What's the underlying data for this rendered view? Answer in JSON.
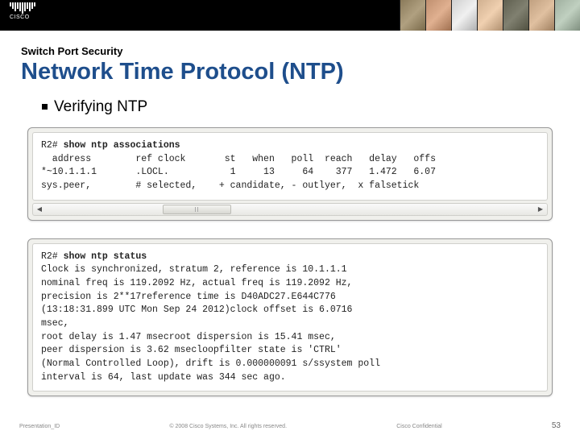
{
  "header": {
    "logo_text": "CISCO"
  },
  "kicker": "Switch Port Security",
  "title": "Network Time Protocol (NTP)",
  "bullet": "Verifying NTP",
  "terminal1": {
    "prompt": "R2#",
    "command": "show ntp associations",
    "line1": "  address        ref clock       st   when   poll  reach   delay   offs",
    "line2": "*~10.1.1.1       .LOCL.           1     13     64    377   1.472   6.07",
    "line3": "sys.peer,        # selected,    + candidate, - outlyer,  x falsetick"
  },
  "terminal2": {
    "prompt": "R2#",
    "command": "show ntp status",
    "line1": "Clock is synchronized, stratum 2, reference is 10.1.1.1",
    "line2": "nominal freq is 119.2092 Hz, actual freq is 119.2092 Hz,",
    "line3": "precision is 2**17reference time is D40ADC27.E644C776",
    "line4": "(13:18:31.899 UTC Mon Sep 24 2012)clock offset is 6.0716",
    "line5": "msec,",
    "line6": "root delay is 1.47 msecroot dispersion is 15.41 msec,",
    "line7": "peer dispersion is 3.62 msecloopfilter state is 'CTRL'",
    "line8": "(Normal Controlled Loop), drift is 0.000000091 s/ssystem poll",
    "line9": "interval is 64, last update was 344 sec ago."
  },
  "footer": {
    "left": "Presentation_ID",
    "center": "© 2008 Cisco Systems, Inc. All rights reserved.",
    "right": "Cisco Confidential",
    "page": "53"
  }
}
